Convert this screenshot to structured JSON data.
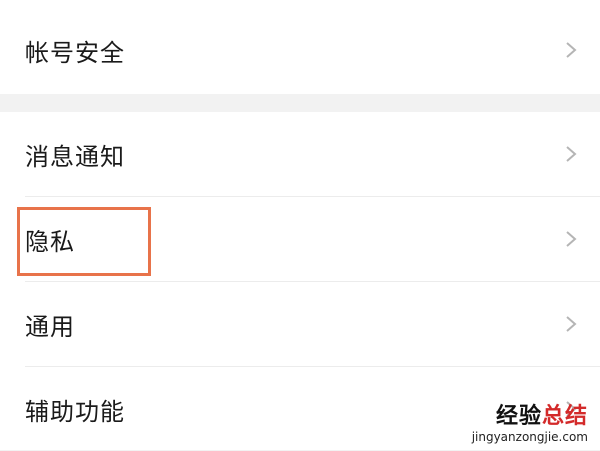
{
  "settings": {
    "account_security": "帐号安全",
    "notifications": "消息通知",
    "privacy": "隐私",
    "general": "通用",
    "accessibility": "辅助功能"
  },
  "icons": {
    "chevron": "chevron-right-icon"
  },
  "colors": {
    "highlight": "#e8734a",
    "watermark_red": "#d32a2a"
  },
  "watermark": {
    "part1": "经验",
    "part2": "总结",
    "url": "jingyanzongjie.com"
  }
}
